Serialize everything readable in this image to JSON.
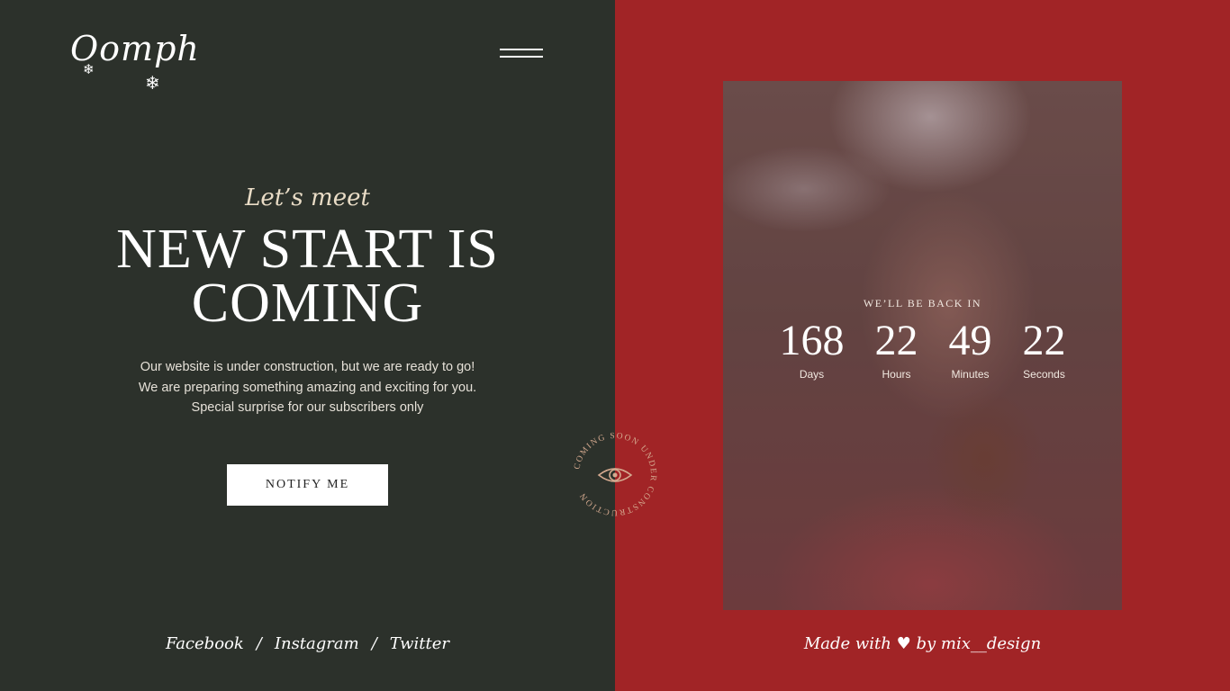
{
  "brand": {
    "logo_text": "Oomph"
  },
  "hero": {
    "kicker": "Let’s meet",
    "headline_line1": "NEW START IS",
    "headline_line2": "COMING",
    "description": [
      "Our website is under construction, but we are ready to go!",
      "We are preparing something amazing and exciting for you.",
      "Special surprise for our subscribers only"
    ],
    "notify_label": "NOTIFY ME"
  },
  "socials": {
    "facebook": "Facebook",
    "instagram": "Instagram",
    "twitter": "Twitter",
    "separator": "/"
  },
  "countdown": {
    "label": "WE’LL BE BACK IN",
    "units": [
      {
        "value": "168",
        "label": "Days"
      },
      {
        "value": "22",
        "label": "Hours"
      },
      {
        "value": "49",
        "label": "Minutes"
      },
      {
        "value": "22",
        "label": "Seconds"
      }
    ]
  },
  "badge": {
    "ring_text": "COMING SOON UNDER CONSTRUCTION"
  },
  "credit": {
    "prefix": "Made with",
    "suffix": "by mix__design"
  },
  "colors": {
    "left_bg": "#2c312b",
    "right_bg": "#a12426",
    "accent_cream": "#e9dcc6",
    "badge": "#d4a98f"
  },
  "icons": {
    "menu": "hamburger-icon",
    "snowflake": "snowflake-icon",
    "eye": "eye-icon",
    "heart": "heart-icon"
  }
}
